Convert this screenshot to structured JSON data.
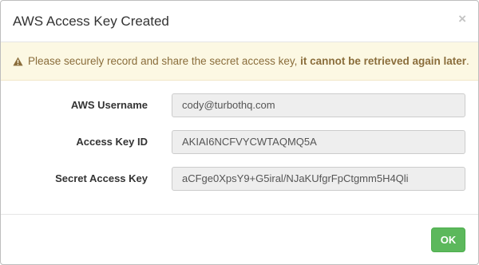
{
  "dialog": {
    "title": "AWS Access Key Created",
    "close_label": "×"
  },
  "warning": {
    "icon": "warning-icon",
    "text_before": "Please securely record and share the secret access key, ",
    "text_emphasis": "it cannot be retrieved again later",
    "text_after": "."
  },
  "fields": [
    {
      "label": "AWS Username",
      "value": "cody@turbothq.com"
    },
    {
      "label": "Access Key ID",
      "value": "AKIAI6NCFVYCWTAQMQ5A"
    },
    {
      "label": "Secret Access Key",
      "value": "aCFge0XpsY9+G5iral/NJaKUfgrFpCtgmm5H4Qli"
    }
  ],
  "footer": {
    "ok_label": "OK"
  },
  "colors": {
    "warning_bg": "#fcf8e3",
    "warning_text": "#8a6d3b",
    "ok_button": "#5cb85c",
    "field_bg": "#eeeeee"
  }
}
